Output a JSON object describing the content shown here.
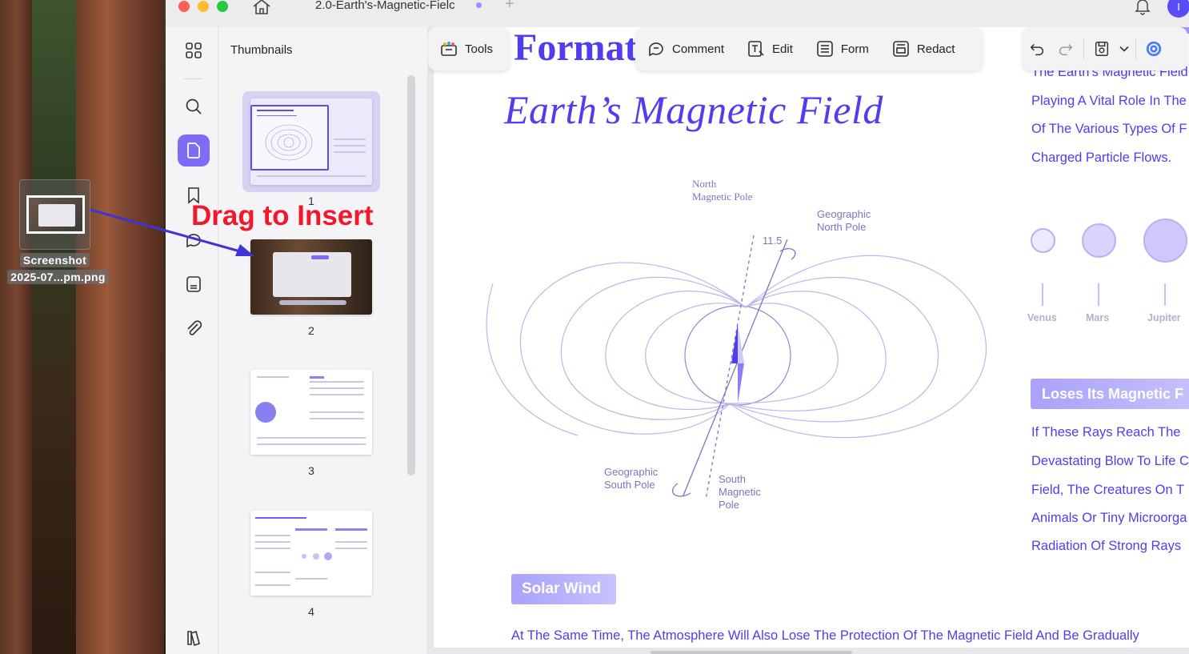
{
  "desktop": {
    "dragged_file_label_line1": "Screenshot",
    "dragged_file_label_line2": "2025-07...pm.png"
  },
  "titlebar": {
    "doc_tab_title": "2.0-Earth's-Magnetic-Fielc",
    "new_tab_symbol": "+",
    "avatar_letter": "I"
  },
  "rail": {
    "icons": [
      "thumbnails-grid-icon",
      "search-icon",
      "page-icon",
      "bookmark-icon",
      "comment-icon",
      "stamp-icon",
      "attachment-icon",
      "layers-icon"
    ]
  },
  "thumbnails": {
    "title": "Thumbnails",
    "pages": [
      {
        "number": "1"
      },
      {
        "number": "2"
      },
      {
        "number": "3"
      },
      {
        "number": "4"
      }
    ]
  },
  "overlay": {
    "drag_hint": "Drag to Insert",
    "arrow_color": "#3f33d6"
  },
  "toolbar": {
    "tools_label": "Tools",
    "comment_label": "Comment",
    "edit_label": "Edit",
    "form_label": "Form",
    "redact_label": "Redact"
  },
  "document": {
    "title_partial": "Format",
    "heading": "Earth’s Magnetic Field",
    "diagram_labels": {
      "north_magnetic_pole": "North\nMagnetic Pole",
      "geographic_north_pole": "Geographic\nNorth Pole",
      "angle": "11.5",
      "geographic_south_pole": "Geographic\nSouth Pole",
      "south_magnetic_pole": "South\nMagnetic\nPole"
    },
    "right_column_top": [
      "The Earth's Magnetic Field",
      "Playing A Vital Role In The",
      "Of The Various Types Of F",
      "Charged Particle Flows."
    ],
    "planets": [
      "Venus",
      "Mars",
      "Jupiter"
    ],
    "loses_banner": "Loses Its Magnetic F",
    "right_column_bottom": [
      "If These Rays Reach The",
      "Devastating Blow To Life C",
      "Field, The Creatures On T",
      "Animals Or Tiny Microorga",
      "Radiation Of Strong Rays"
    ],
    "solar_banner": "Solar Wind",
    "bottom_text": "At The Same Time, The Atmosphere Will Also Lose The Protection Of The Magnetic Field And Be Gradually"
  },
  "colors": {
    "accent": "#7c6cf6",
    "doc_text": "#4f3df0",
    "drag_hint": "#f2182b"
  }
}
